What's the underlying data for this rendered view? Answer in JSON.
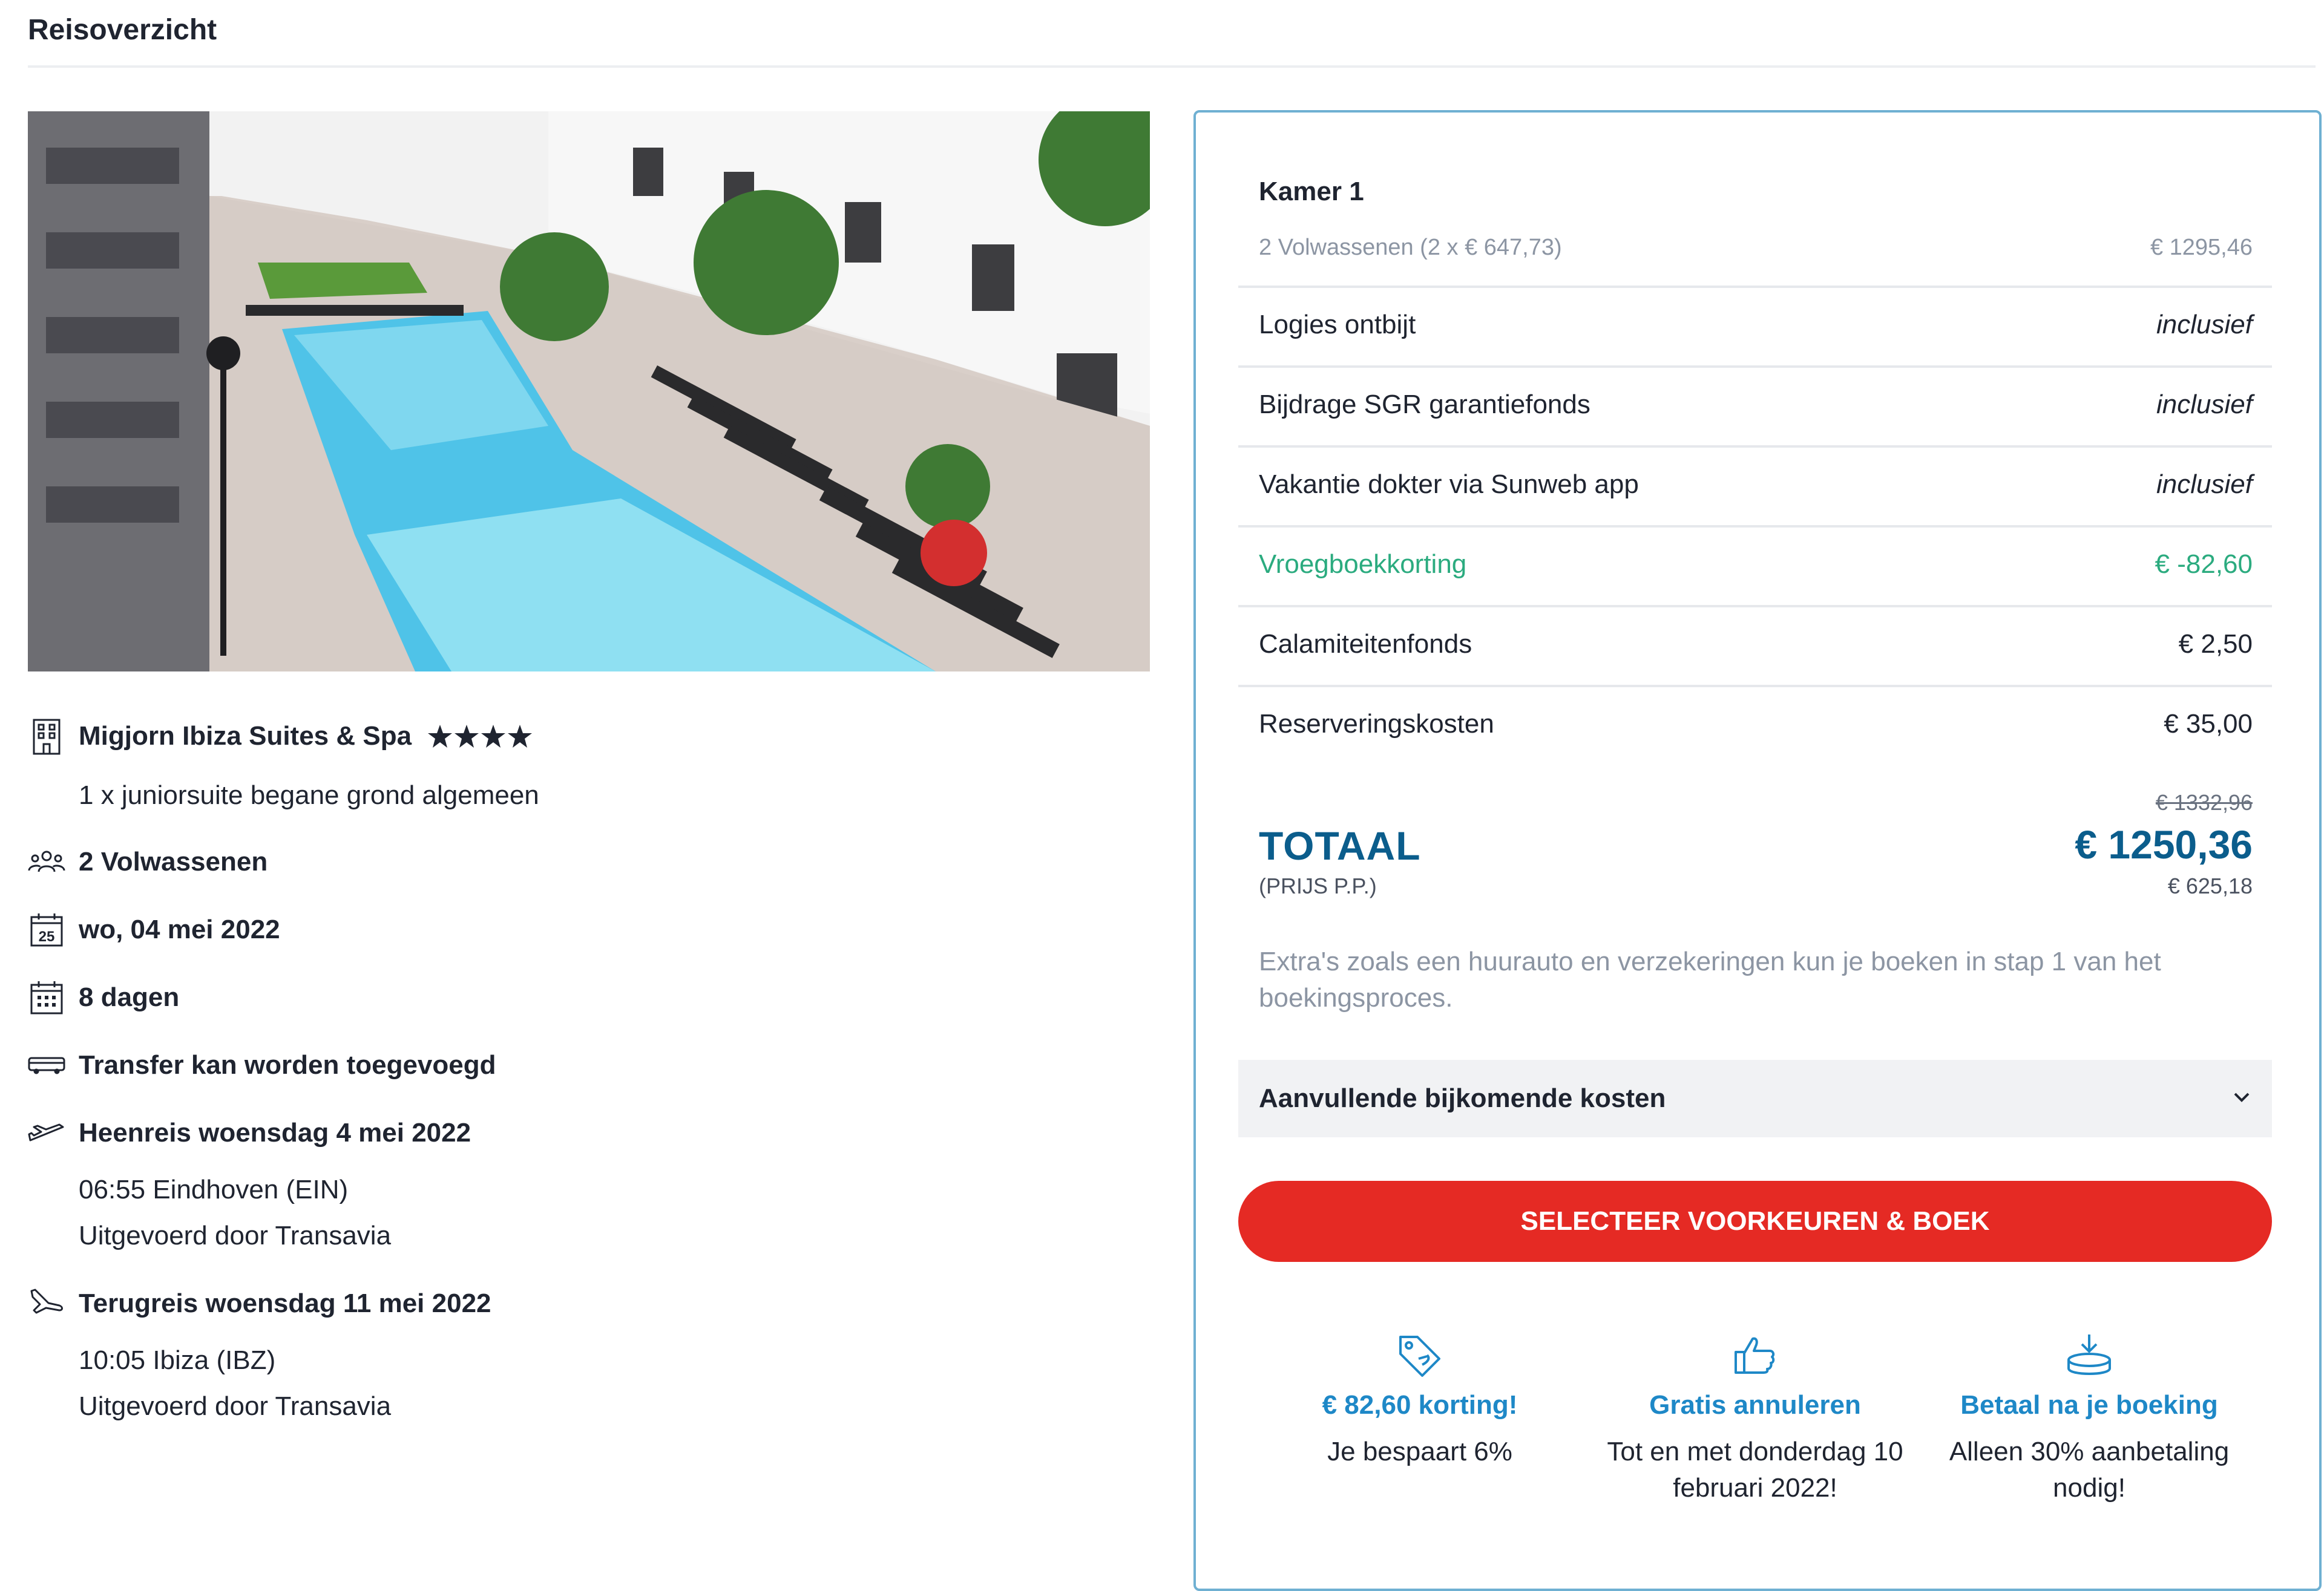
{
  "header": {
    "title": "Reisoverzicht"
  },
  "hotel": {
    "name": "Migjorn Ibiza Suites & Spa",
    "rating": 4.5,
    "rating_max": 5,
    "room": "1 x juniorsuite begane grond algemeen"
  },
  "trip": {
    "travellers": "2 Volwassenen",
    "date": "wo, 04 mei 2022",
    "duration": "8 dagen",
    "transfer": "Transfer kan worden toegevoegd",
    "outbound": {
      "title": "Heenreis woensdag 4 mei 2022",
      "departure": "06:55 Eindhoven (EIN)",
      "carrier": "Uitgevoerd door Transavia"
    },
    "return": {
      "title": "Terugreis woensdag 11 mei 2022",
      "departure": "10:05 Ibiza (IBZ)",
      "carrier": "Uitgevoerd door Transavia"
    }
  },
  "price": {
    "room_title": "Kamer 1",
    "room_detail": "2 Volwassenen (2 x € 647,73)",
    "room_price": "€ 1295,46",
    "lines": [
      {
        "label": "Logies ontbijt",
        "value": "inclusief"
      },
      {
        "label": "Bijdrage SGR garantiefonds",
        "value": "inclusief"
      },
      {
        "label": "Vakantie dokter via Sunweb app",
        "value": "inclusief"
      },
      {
        "label": "Vroegboekkorting",
        "value": "€ -82,60"
      },
      {
        "label": "Calamiteitenfonds",
        "value": "€ 2,50"
      },
      {
        "label": "Reserveringskosten",
        "value": "€ 35,00"
      }
    ],
    "old_total": "€ 1332,96",
    "total_label": "TOTAAL",
    "total_value": "€ 1250,36",
    "per_person_label": "(PRIJS P.P.)",
    "per_person_value": "€ 625,18",
    "extras_note": "Extra's zoals een huurauto en verzekeringen kun je boeken in stap 1 van het boekingsproces.",
    "accordion_label": "Aanvullende bijkomende kosten",
    "cta_label": "SELECTEER VOORKEUREN & BOEK"
  },
  "usps": [
    {
      "icon": "price-tag-icon",
      "title": "€ 82,60 korting!",
      "text": "Je bespaart 6%"
    },
    {
      "icon": "thumbs-up-icon",
      "title": "Gratis annuleren",
      "text": "Tot en met donderdag 10 februari 2022!"
    },
    {
      "icon": "payment-download-icon",
      "title": "Betaal na je boeking",
      "text": "Alleen 30% aanbetaling nodig!"
    }
  ],
  "colors": {
    "accent_blue": "#0b5d8c",
    "usp_blue": "#1e88c7",
    "discount_green": "#2bab7f",
    "cta_red": "#e52a24",
    "card_border": "#6fb0d2"
  }
}
